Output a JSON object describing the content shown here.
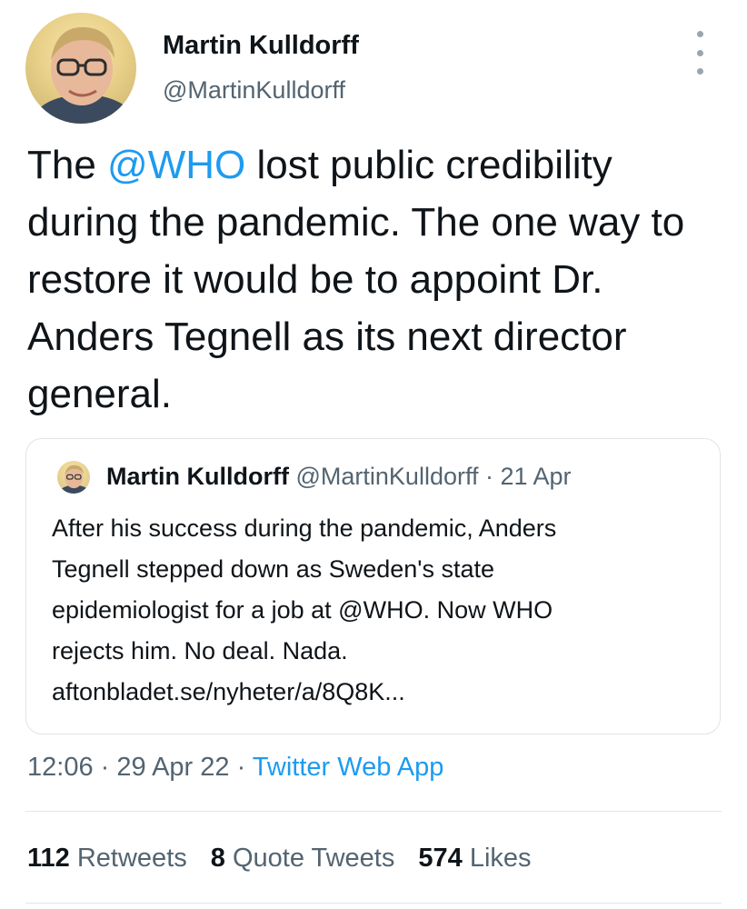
{
  "author": {
    "name": "Martin Kulldorff",
    "handle": "@MartinKulldorff"
  },
  "tweet": {
    "text_prefix": "The ",
    "mention": "@WHO",
    "text_rest": " lost public credibility during the pandemic. The one way to restore it would be to appoint Dr. Anders Tegnell as its next director general."
  },
  "quoted_tweet": {
    "name": "Martin Kulldorff",
    "handle": "@MartinKulldorff",
    "separator": " · ",
    "date": "21 Apr",
    "lines": [
      "After his success during the pandemic, Anders",
      "Tegnell stepped down as Sweden's state",
      "epidemiologist for a job at @WHO. Now WHO",
      "rejects him. No deal. Nada.",
      "aftonbladet.se/nyheter/a/8Q8K..."
    ]
  },
  "meta": {
    "time": "12:06",
    "date": "29 Apr 22",
    "app": "Twitter Web App"
  },
  "stats": {
    "retweets_count": "112",
    "retweets_label": "Retweets",
    "quotes_count": "8",
    "quotes_label": "Quote Tweets",
    "likes_count": "574",
    "likes_label": "Likes"
  },
  "colors": {
    "link": "#1d9bf0",
    "secondary": "#536471",
    "primary": "#0f1419"
  },
  "icons": {
    "more": "more-vertical-icon",
    "avatar": "profile-photo"
  }
}
